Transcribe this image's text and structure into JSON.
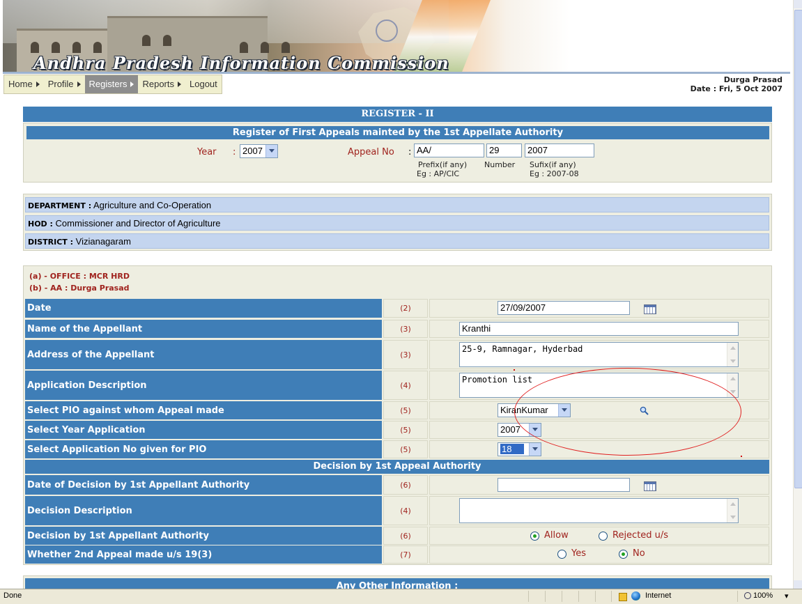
{
  "banner": {
    "title": "Andhra Pradesh Information Commission"
  },
  "nav": [
    {
      "label": "Home",
      "active": false
    },
    {
      "label": "Profile",
      "active": false
    },
    {
      "label": "Registers",
      "active": true
    },
    {
      "label": "Reports",
      "active": false
    },
    {
      "label": "Logout",
      "active": false
    }
  ],
  "user": {
    "name": "Durga Prasad",
    "date": "Date : Fri, 5 Oct 2007"
  },
  "register": {
    "title": "REGISTER - II",
    "subtitle": "Register of First Appeals mainted by the 1st Appellate Authority",
    "year_label": "Year",
    "colon": ":",
    "year_value": "2007",
    "appeal_label": "Appeal No",
    "prefix_value": "AA/",
    "number_value": "29",
    "suffix_value": "2007",
    "prefix_hint_1": "Prefix(if any)",
    "prefix_hint_2": "Eg : AP/CIC",
    "number_hint": "Number",
    "suffix_hint_1": "Sufix(if any)",
    "suffix_hint_2": "Eg : 2007-08"
  },
  "department": {
    "dept_label": "DEPARTMENT :",
    "dept_value": "Agriculture and Co-Operation",
    "hod_label": "HOD :",
    "hod_value": "Commissioner and Director of Agriculture",
    "district_label": "DISTRICT :",
    "district_value": "Vizianagaram"
  },
  "office": {
    "line_a": "(a) - OFFICE : MCR HRD",
    "line_b": "(b) - AA : Durga Prasad"
  },
  "form": {
    "date": {
      "label": "Date",
      "num": "(2)",
      "value": "27/09/2007"
    },
    "appellant_name": {
      "label": "Name of the Appellant",
      "num": "(3)",
      "value": "Kranthi"
    },
    "appellant_address": {
      "label": "Address of the Appellant",
      "num": "(3)",
      "value": "25-9, Ramnagar, Hyderbad"
    },
    "application_desc": {
      "label": "Application Description",
      "num": "(4)",
      "value": "Promotion list"
    },
    "pio": {
      "label": "Select PIO against whom Appeal made",
      "num": "(5)",
      "value": "KiranKumar"
    },
    "year_app": {
      "label": "Select Year Application",
      "num": "(5)",
      "value": "2007"
    },
    "app_no": {
      "label": "Select Application No given for PIO",
      "num": "(5)",
      "value": "18"
    }
  },
  "decision": {
    "header": "Decision by 1st Appeal Authority",
    "date": {
      "label": "Date of Decision by 1st Appellant Authority",
      "num": "(6)",
      "value": ""
    },
    "desc": {
      "label": "Decision Description",
      "num": "(4)",
      "value": ""
    },
    "outcome": {
      "label": "Decision by 1st Appellant Authority",
      "num": "(6)",
      "opt1": "Allow",
      "opt2": "Rejected u/s",
      "selected": "Allow"
    },
    "second_appeal": {
      "label": "Whether 2nd Appeal made u/s 19(3)",
      "num": "(7)",
      "opt1": "Yes",
      "opt2": "No",
      "selected": "No"
    }
  },
  "other_info": {
    "header": "Any Other Information :"
  },
  "statusbar": {
    "left": "Done",
    "zone": "Internet",
    "zoom": "100%"
  },
  "colors": {
    "header_blue": "#3f7eb7",
    "panel_bg": "#eeeee1",
    "dept_bg": "#c4d5ef",
    "label_red": "#a0231e",
    "annotation": "#e02020"
  }
}
